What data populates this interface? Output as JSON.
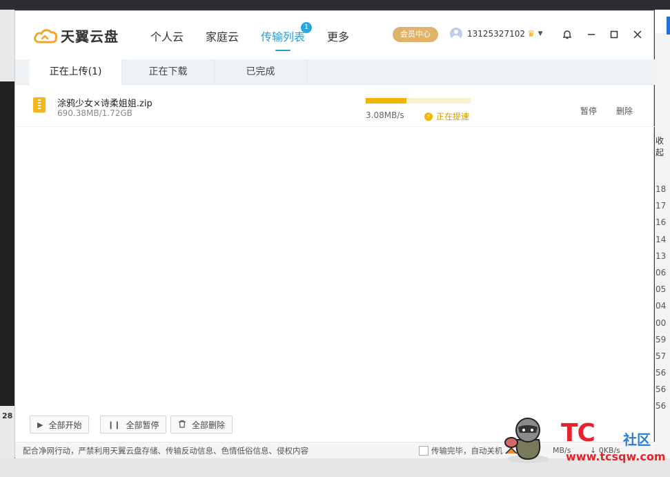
{
  "app": {
    "name": "天翼云盘"
  },
  "nav": [
    {
      "label": "个人云",
      "active": false
    },
    {
      "label": "家庭云",
      "active": false
    },
    {
      "label": "传输列表",
      "active": true,
      "badge": "1"
    },
    {
      "label": "更多",
      "active": false
    }
  ],
  "header": {
    "vip_label": "会员中心",
    "username": "13125327102"
  },
  "tabs": [
    {
      "label": "正在上传(1)",
      "active": true
    },
    {
      "label": "正在下载",
      "active": false
    },
    {
      "label": "已完成",
      "active": false
    }
  ],
  "transfers": [
    {
      "name": "涂鸦少女×诗柔姐姐.zip",
      "size_text": "690.38MB/1.72GB",
      "progress": 0.39,
      "speed": "3.08MB/s",
      "status": "正在提速",
      "actions": [
        "暂停",
        "删除"
      ]
    }
  ],
  "footer": {
    "start_all": "全部开始",
    "pause_all": "全部暂停",
    "delete_all": "全部删除"
  },
  "statusbar": {
    "notice": "配合净网行动，严禁利用天翼云盘存储、传输反动信息、色情低俗信息、侵权内容",
    "shutdown_label": "传输完毕，自动关机",
    "upload_speed": "MB/s",
    "download_speed": "0KB/s"
  },
  "watermark": {
    "brand": "TC",
    "sub": "社区",
    "url": "www.tcsqw.com"
  },
  "background": {
    "left_number": "28",
    "right_text": "收起",
    "times": [
      "18",
      "17",
      "16",
      "14",
      "13",
      "06",
      "05",
      "04",
      "00",
      "59",
      "57",
      "56",
      "56",
      "56"
    ]
  },
  "colors": {
    "accent": "#2a9fd6",
    "progress": "#f2b400",
    "vip": "#e0b36a",
    "brand_red": "#e8222b"
  }
}
